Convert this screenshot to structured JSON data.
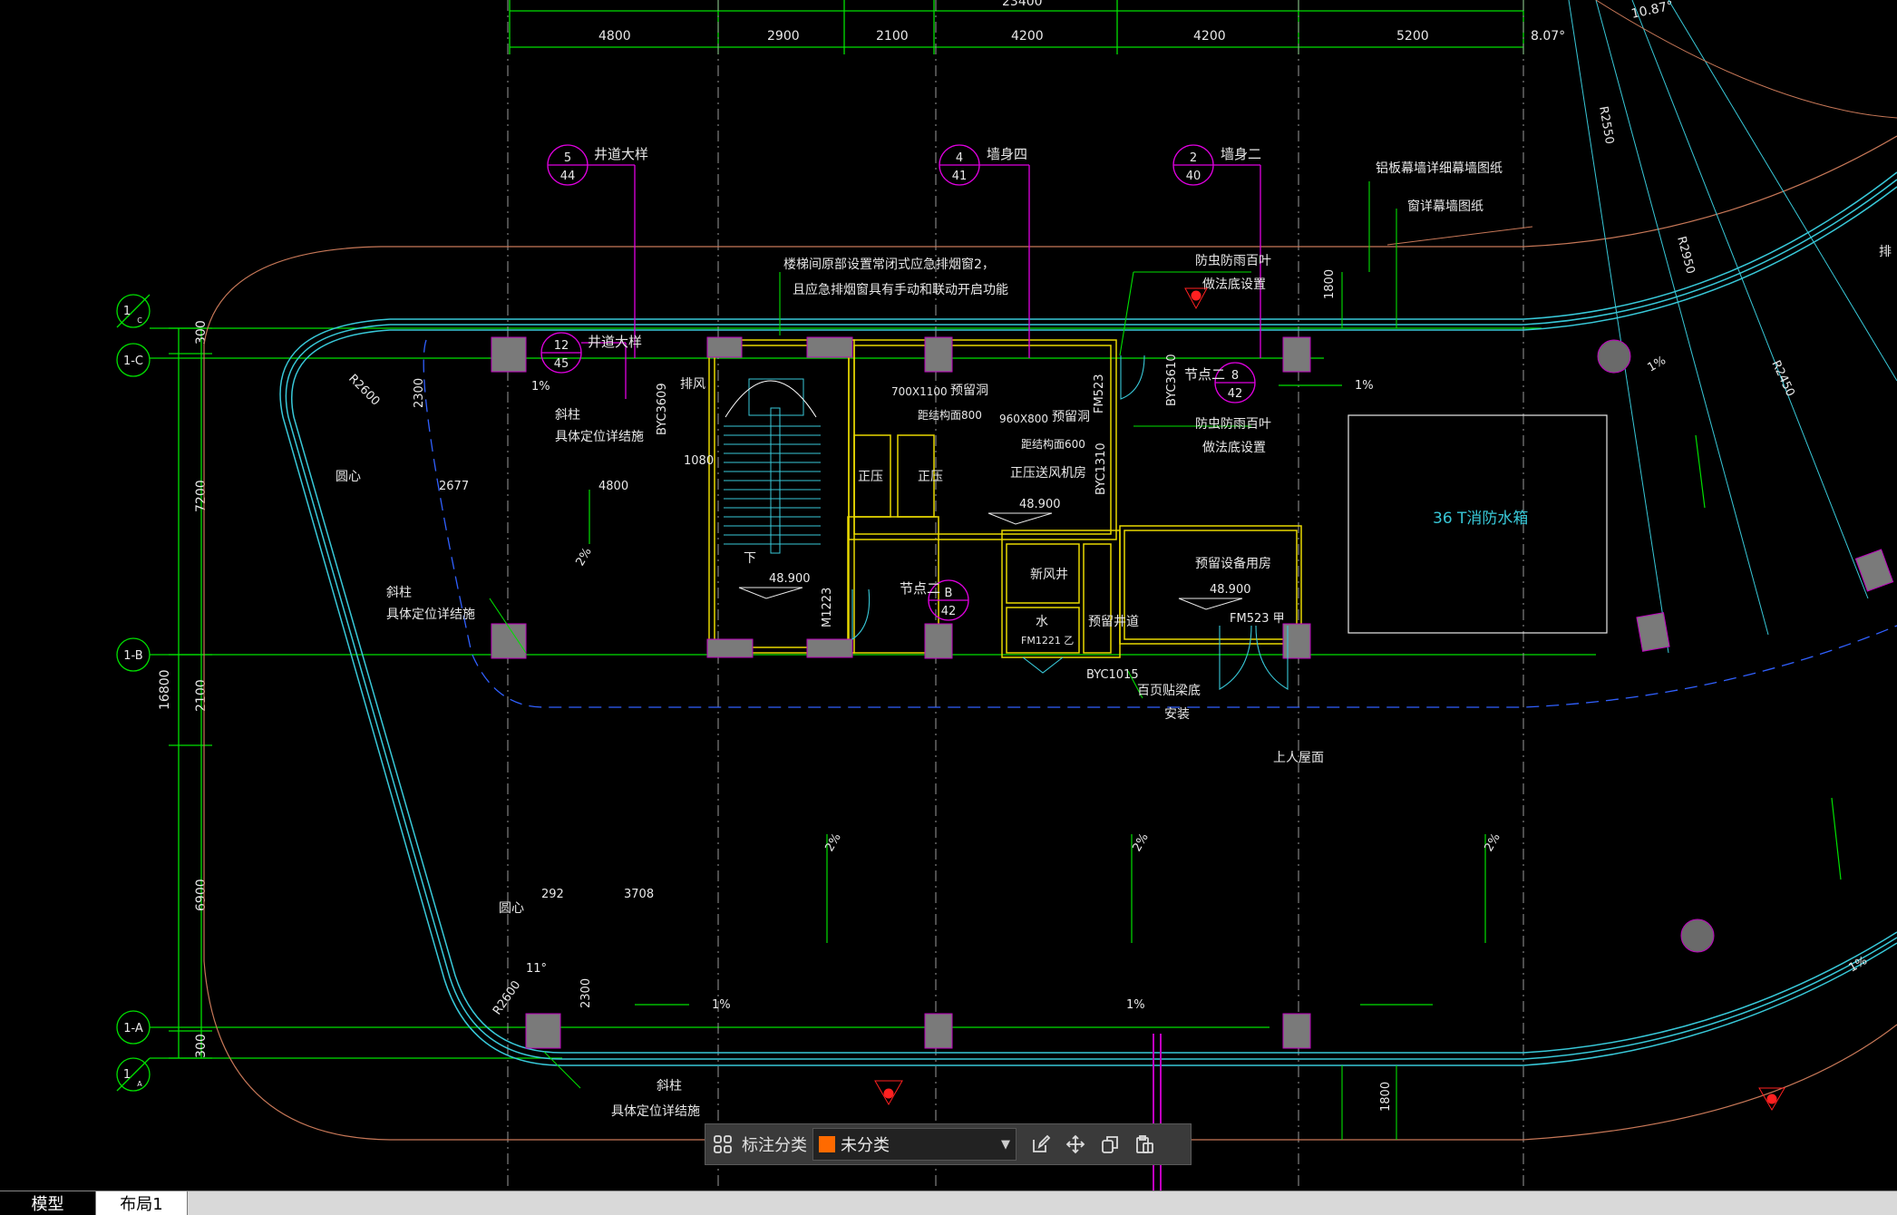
{
  "drawing": {
    "top_dims": [
      "4800",
      "2900",
      "2100",
      "4200",
      "4200",
      "5200",
      "8.07°",
      "10.87°"
    ],
    "left_dims": [
      "300",
      "7200",
      "2100",
      "6900",
      "300",
      "16800"
    ],
    "grid_labels": [
      "1-C",
      "1-B",
      "1-A"
    ],
    "grid_bubble_1_top": "1",
    "grid_bubble_1_top_sub": "C",
    "grid_bubble_1_bottom": "1",
    "grid_bubble_1_bottom_sub": "A",
    "callouts": [
      {
        "num": "5",
        "sheet": "44",
        "text": "井道大样"
      },
      {
        "num": "4",
        "sheet": "41",
        "text": "墙身四"
      },
      {
        "num": "2",
        "sheet": "40",
        "text": "墙身二"
      },
      {
        "num": "12",
        "sheet": "45",
        "text": "井道大样"
      },
      {
        "num": "8",
        "sheet": "42",
        "text": "节点二"
      },
      {
        "num": "B",
        "sheet": "42",
        "text": "节点二"
      }
    ],
    "notes": {
      "stair_note_1": "楼梯间原部设置常闭式应急排烟窗2，",
      "stair_note_2": "且应急排烟窗具有手动和联动开启功能",
      "aluminum": "铝板幕墙详细幕墙图纸",
      "curtain": "窗详幕墙图纸",
      "insect_1": "防虫防雨百叶",
      "insect_1b": "做法底设置",
      "insect_2": "防虫防雨百叶",
      "insect_2b": "做法底设置",
      "slant_col": "斜柱",
      "slant_col_detail": "具体定位详结施",
      "center": "圆心",
      "exhaust": "排风",
      "reserved_hole_1": "预留洞",
      "reserved_hole_2": "预留洞",
      "hole_1": "700X1100",
      "hole_2": "960X800",
      "sill_1": "距结构面800",
      "sill_2": "距结构面600",
      "pressure_1": "正压",
      "pressure_2": "正压",
      "fan_room": "正压送风机房",
      "fresh_air": "新风井",
      "water": "水",
      "reserved_shaft": "预留井道",
      "equipment": "预留设备用房",
      "water_tank": "36 T消防水箱",
      "roof": "上人屋面",
      "louver_1": "百页贴梁底",
      "louver_2": "安装",
      "down": "下"
    },
    "elevations": [
      "48.900",
      "48.900",
      "48.900"
    ],
    "door_tags": [
      "BYC3609",
      "BYC3610",
      "BYC1310",
      "BYC1015",
      "FM523",
      "FM523 甲",
      "FM1221 乙",
      "M1223"
    ],
    "slopes": [
      "1%",
      "1%",
      "1%",
      "2%",
      "2%",
      "2%",
      "2%",
      "1%",
      "1%",
      "1%"
    ],
    "misc_dims": [
      "2300",
      "2677",
      "4800",
      "1080",
      "1800",
      "292",
      "3708",
      "2300",
      "1800",
      "R2600",
      "R2600",
      "R2550",
      "R2950",
      "R2450",
      "11°"
    ],
    "partial_top": "23400",
    "partial_right": "排"
  },
  "toolbar": {
    "label": "标注分类",
    "category_value": "未分类",
    "swatch_color": "#ff6a00",
    "icons": [
      "grid-icon",
      "edit-icon",
      "move-icon",
      "copy-icon",
      "paste-icon"
    ]
  },
  "tabs": {
    "model": "模型",
    "layout": "布局1"
  }
}
